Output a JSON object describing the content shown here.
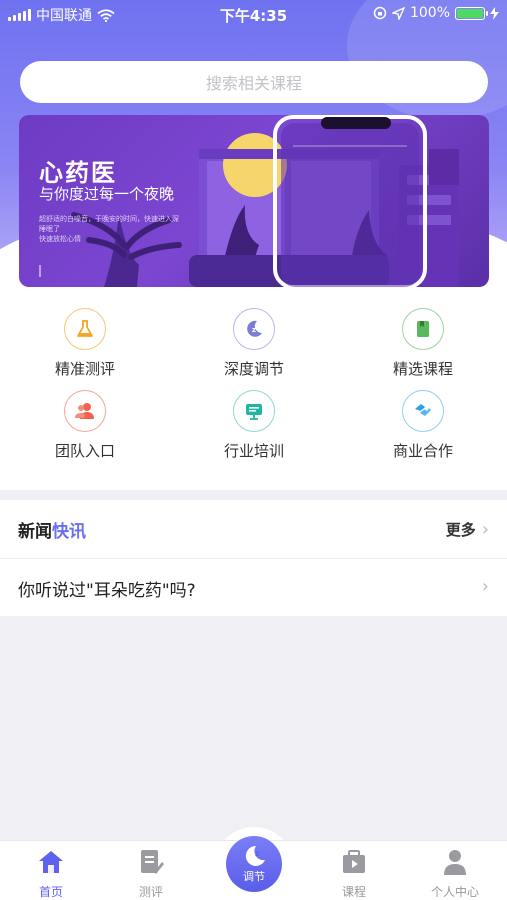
{
  "status_bar": {
    "carrier": "中国联通",
    "time": "下午4:35",
    "battery": "100%"
  },
  "search": {
    "placeholder": "搜索相关课程"
  },
  "banner": {
    "title": "心药医",
    "subtitle": "与你度过每一个夜晚",
    "caption_line1": "超舒适的白噪音，于晚安的时间，快速进入深睡眠了",
    "caption_line2": "快速放松心情"
  },
  "menu": [
    {
      "label": "精准测评",
      "icon": "flask-icon",
      "color": "#f5a623"
    },
    {
      "label": "深度调节",
      "icon": "sleep-moon-icon",
      "color": "#7b7fd4"
    },
    {
      "label": "精选课程",
      "icon": "book-icon",
      "color": "#5cb85c"
    },
    {
      "label": "团队入口",
      "icon": "team-icon",
      "color": "#f0624d"
    },
    {
      "label": "行业培训",
      "icon": "training-icon",
      "color": "#1fb5a3"
    },
    {
      "label": "商业合作",
      "icon": "handshake-icon",
      "color": "#2b9ee8"
    }
  ],
  "news": {
    "title_part1": "新闻",
    "title_part2": "快讯",
    "more": "更多",
    "items": [
      {
        "title": "你听说过\"耳朵吃药\"吗?"
      }
    ]
  },
  "tabbar": {
    "tabs": [
      {
        "label": "首页",
        "icon": "home-icon",
        "active": true
      },
      {
        "label": "测评",
        "icon": "assessment-icon",
        "active": false
      },
      {
        "label": "调节",
        "icon": "sleep-moon-icon",
        "active": false
      },
      {
        "label": "课程",
        "icon": "course-icon",
        "active": false
      },
      {
        "label": "个人中心",
        "icon": "profile-icon",
        "active": false
      }
    ]
  },
  "colors": {
    "accent": "#5f62ee",
    "hero_top": "#6f72f0",
    "banner": "#6e3bc4"
  }
}
